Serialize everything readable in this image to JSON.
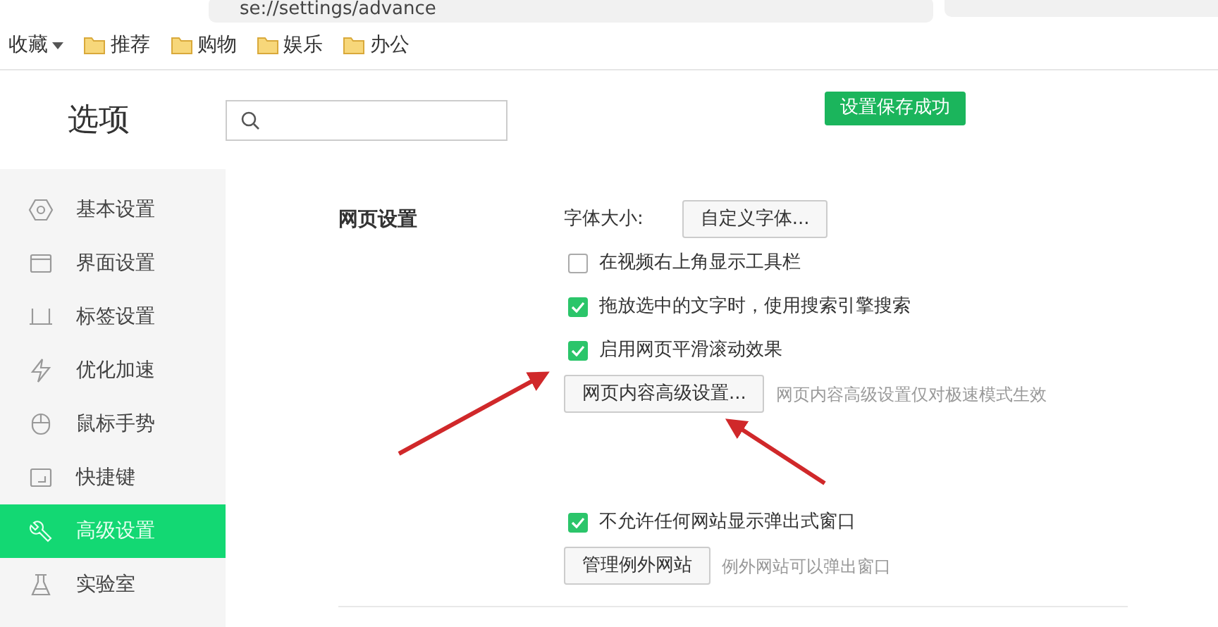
{
  "address_bar": {
    "url": "se://settings/advance"
  },
  "bookmarks": [
    {
      "label": "收藏",
      "kind": "menu"
    },
    {
      "label": "推荐",
      "kind": "folder"
    },
    {
      "label": "购物",
      "kind": "folder"
    },
    {
      "label": "娱乐",
      "kind": "folder"
    },
    {
      "label": "办公",
      "kind": "folder"
    }
  ],
  "header": {
    "title": "选项",
    "toast": "设置保存成功"
  },
  "sidebar": {
    "items": [
      {
        "label": "基本设置",
        "selected": false
      },
      {
        "label": "界面设置",
        "selected": false
      },
      {
        "label": "标签设置",
        "selected": false
      },
      {
        "label": "优化加速",
        "selected": false
      },
      {
        "label": "鼠标手势",
        "selected": false
      },
      {
        "label": "快捷键",
        "selected": false
      },
      {
        "label": "高级设置",
        "selected": true
      },
      {
        "label": "实验室",
        "selected": false
      }
    ]
  },
  "section": {
    "title": "网页设置",
    "rows": [
      {
        "kind": "button",
        "label": "字体大小:",
        "button": "自定义字体..."
      },
      {
        "kind": "checkbox",
        "label": "在视频右上角显示工具栏",
        "checked": false
      },
      {
        "kind": "checkbox",
        "label": "拖放选中的文字时，使用搜索引擎搜索",
        "checked": true
      },
      {
        "kind": "checkbox",
        "label": "启用网页平滑滚动效果",
        "checked": true
      },
      {
        "kind": "button",
        "button": "网页内容高级设置...",
        "hint": "网页内容高级设置仅对极速模式生效"
      },
      {
        "kind": "gap"
      },
      {
        "kind": "checkbox",
        "label": "不允许任何网站显示弹出式窗口",
        "checked": true
      },
      {
        "kind": "button",
        "button": "管理例外网站",
        "hint": "例外网站可以弹出窗口"
      }
    ]
  }
}
